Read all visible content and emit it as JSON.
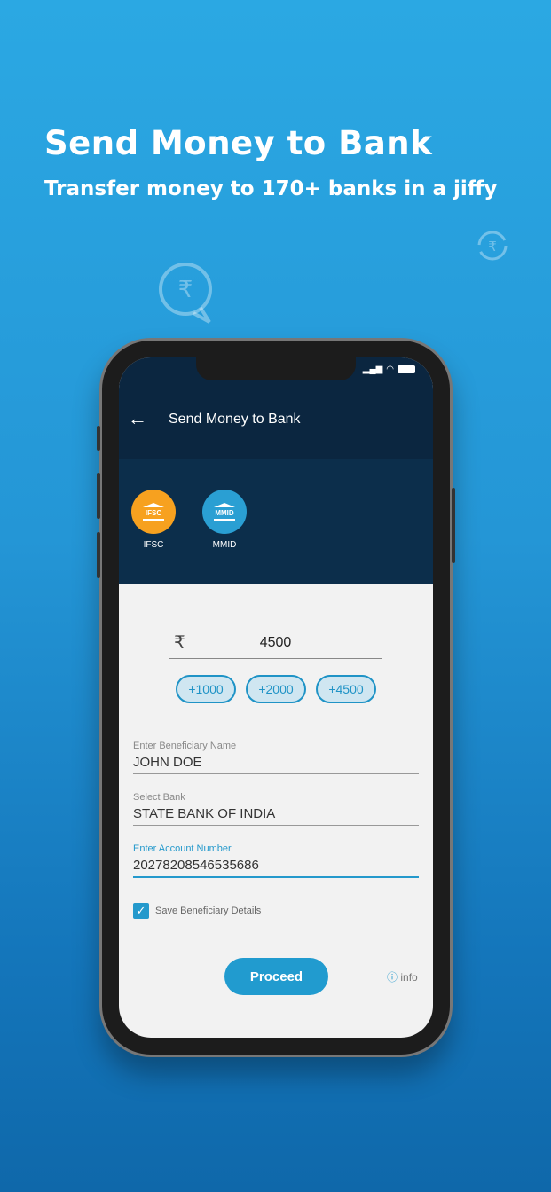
{
  "hero": {
    "title": "Send Money to Bank",
    "subtitle": "Transfer money to 170+ banks in a jiffy"
  },
  "colors": {
    "background": "#2496d6",
    "header": "#0b2640",
    "accent": "#219bcf",
    "ifsc": "#f7a11f",
    "mmid": "#2a9fd3"
  },
  "app": {
    "title": "Send Money to Bank",
    "modes": [
      {
        "label": "IFSC",
        "icon_text": "IFSC"
      },
      {
        "label": "MMID",
        "icon_text": "MMID"
      }
    ],
    "amount": {
      "currency": "₹",
      "value": "4500"
    },
    "quick_amounts": [
      "+1000",
      "+2000",
      "+4500"
    ],
    "fields": [
      {
        "label": "Enter Beneficiary Name",
        "value": "JOHN DOE"
      },
      {
        "label": "Select Bank",
        "value": "STATE BANK OF INDIA"
      },
      {
        "label": "Enter Account Number",
        "value": "20278208546535686"
      }
    ],
    "save_label": "Save Beneficiary Details",
    "save_checked": true,
    "proceed": "Proceed",
    "info": "info"
  }
}
